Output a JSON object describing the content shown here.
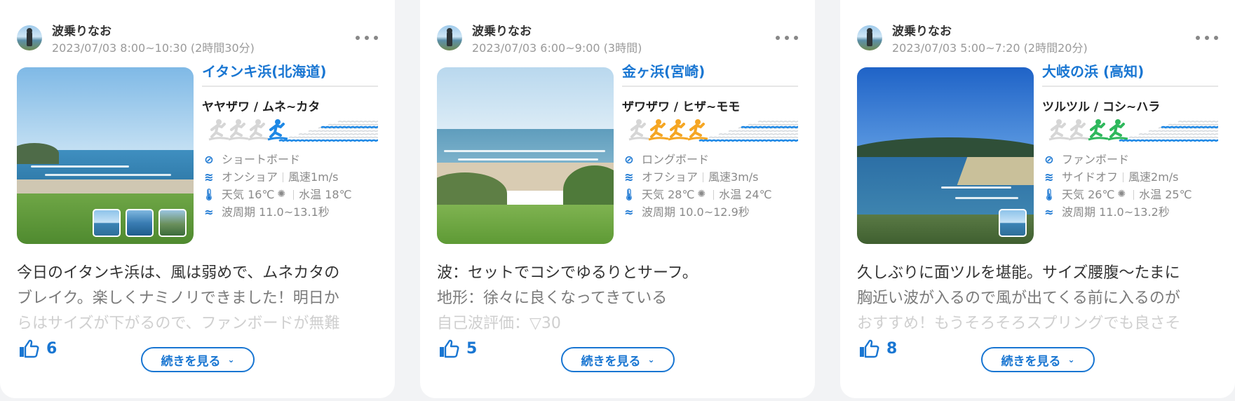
{
  "posts": [
    {
      "user": "波乗りなお",
      "session": "2023/07/03 8:00~10:30 (2時間30分)",
      "beach": "イタンキ浜(北海道)",
      "wave_quality": "ヤヤザワ / ムネ~カタ",
      "surfer_rating": 1,
      "surfer_color": "#1e88e5",
      "board": "ショートボード",
      "wind_dir": "オンショア",
      "wind_speed": "風速1m/s",
      "weather": "天気 16℃",
      "water_temp": "水温 18℃",
      "wave_period": "波周期 11.0~13.1秒",
      "text_lines": [
        "今日のイタンキ浜は、風は弱めで、ムネカタの",
        "ブレイク。楽しくナミノリできました！明日か",
        "らはサイズが下がるので、ファンボードが無難"
      ],
      "likes": "6",
      "more_label": "続きを見る",
      "photo_thumbs": 3
    },
    {
      "user": "波乗りなお",
      "session": "2023/07/03 6:00~9:00 (3時間)",
      "beach": "金ヶ浜(宮崎)",
      "wave_quality": "ザワザワ / ヒザ~モモ",
      "surfer_rating": 3,
      "surfer_color": "#f5a623",
      "board": "ロングボード",
      "wind_dir": "オフショア",
      "wind_speed": "風速3m/s",
      "weather": "天気 28℃",
      "water_temp": "水温 24℃",
      "wave_period": "波周期 10.0~12.9秒",
      "text_lines": [
        "波：セットでコシでゆるりとサーフ。",
        "地形：徐々に良くなってきている",
        "自己波評価：▽30"
      ],
      "likes": "5",
      "more_label": "続きを見る",
      "photo_thumbs": 0
    },
    {
      "user": "波乗りなお",
      "session": "2023/07/03 5:00~7:20 (2時間20分)",
      "beach": "大岐の浜 (高知)",
      "wave_quality": "ツルツル / コシ~ハラ",
      "surfer_rating": 2,
      "surfer_color": "#2eb85c",
      "board": "ファンボード",
      "wind_dir": "サイドオフ",
      "wind_speed": "風速2m/s",
      "weather": "天気 26℃",
      "water_temp": "水温 25℃",
      "wave_period": "波周期 11.0~13.2秒",
      "text_lines": [
        "久しぶりに面ツルを堪能。サイズ腰腹〜たまに",
        "胸近い波が入るので風が出てくる前に入るのが",
        "おすすめ！もうそろそろスプリングでも良さそ"
      ],
      "likes": "8",
      "more_label": "続きを見る",
      "photo_thumbs": 1
    }
  ],
  "icons": {
    "menu": "more-dots-icon",
    "board": "surfboard-icon",
    "wind": "wind-icon",
    "weather": "thermometer-icon",
    "wave": "wave-icon",
    "like": "thumbs-up-icon",
    "chevron": "chevron-down-icon"
  },
  "colors": {
    "accent": "#1976d2",
    "wave_blue": "#1e88e5"
  }
}
